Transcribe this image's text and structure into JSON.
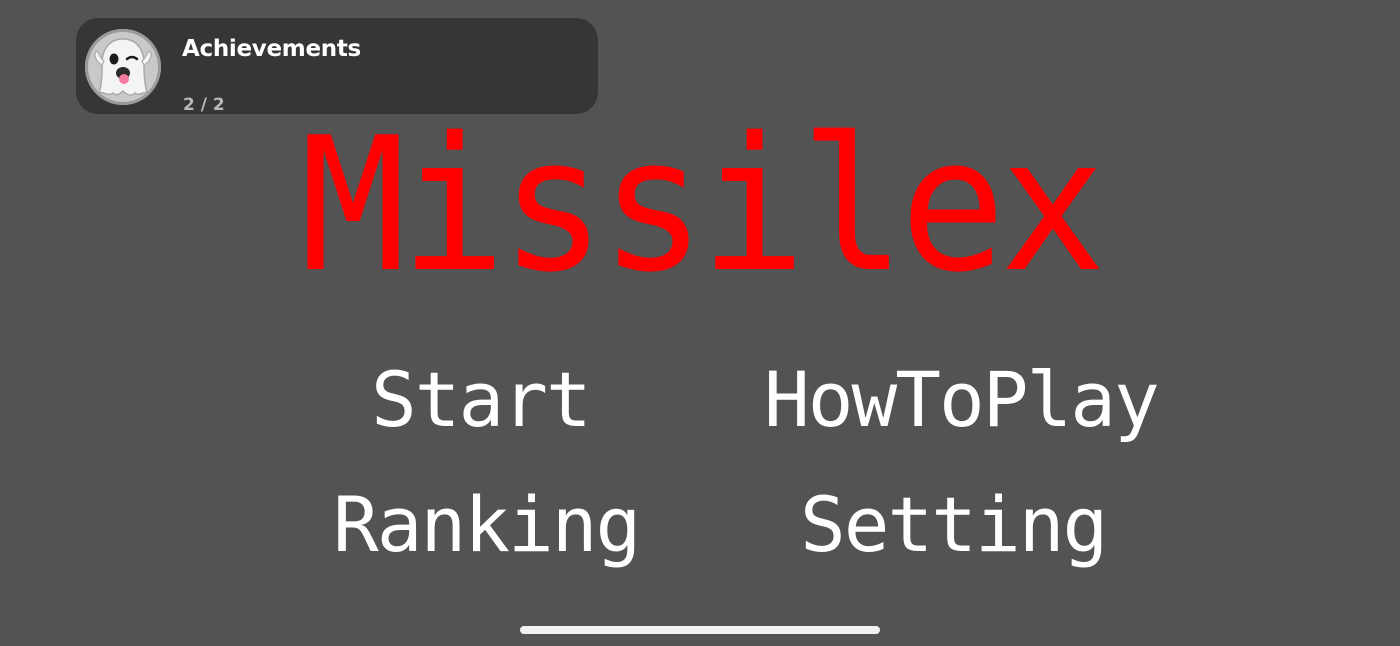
{
  "toast": {
    "title": "Achievements",
    "progress": "2 / 2",
    "icon": "ghost-emoji-icon"
  },
  "game": {
    "title": "Missilex",
    "title_color": "#ff0000"
  },
  "menu": {
    "start": "Start",
    "how_to_play": "HowToPlay",
    "ranking": "Ranking",
    "setting": "Setting"
  },
  "colors": {
    "background": "#535353",
    "toast_bg": "#363636",
    "menu_text": "#ffffff"
  }
}
